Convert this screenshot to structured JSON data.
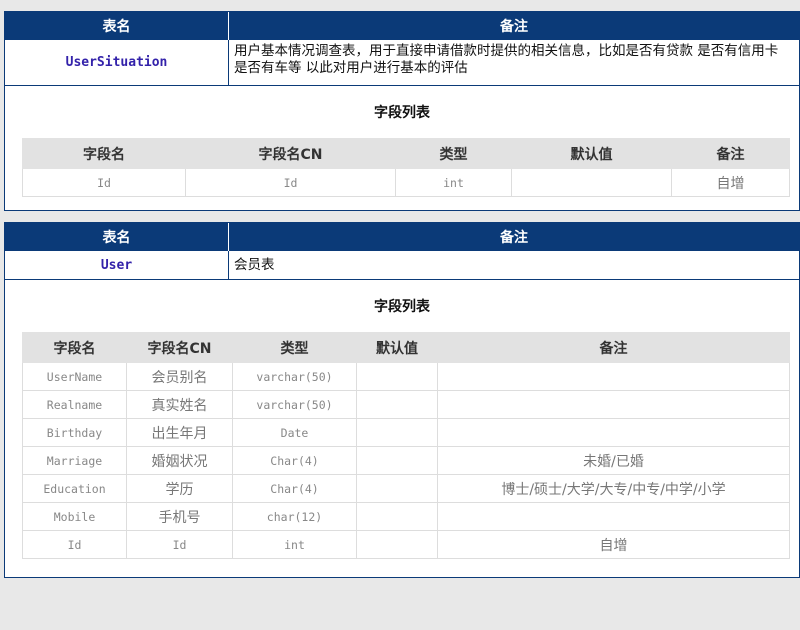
{
  "header": {
    "name_label": "表名",
    "remark_label": "备注"
  },
  "fields_title": "字段列表",
  "columns": [
    "字段名",
    "字段名CN",
    "类型",
    "默认值",
    "备注"
  ],
  "tables": [
    {
      "name": "UserSituation",
      "remark": "用户基本情况调查表，用于直接申请借款时提供的相关信息，比如是否有贷款 是否有信用卡 是否有车等 以此对用户进行基本的评估",
      "rows": [
        {
          "field": "Id",
          "field_cn": "Id",
          "type": "int",
          "default": "",
          "remark": "自增"
        }
      ]
    },
    {
      "name": "User",
      "remark": "会员表",
      "rows": [
        {
          "field": "UserName",
          "field_cn": "会员别名",
          "type": "varchar(50)",
          "default": "",
          "remark": ""
        },
        {
          "field": "Realname",
          "field_cn": "真实姓名",
          "type": "varchar(50)",
          "default": "",
          "remark": ""
        },
        {
          "field": "Birthday",
          "field_cn": "出生年月",
          "type": "Date",
          "default": "",
          "remark": ""
        },
        {
          "field": "Marriage",
          "field_cn": "婚姻状况",
          "type": "Char(4)",
          "default": "",
          "remark": "未婚/已婚"
        },
        {
          "field": "Education",
          "field_cn": "学历",
          "type": "Char(4)",
          "default": "",
          "remark": "博士/硕士/大学/大专/中专/中学/小学"
        },
        {
          "field": "Mobile",
          "field_cn": "手机号",
          "type": "char(12)",
          "default": "",
          "remark": ""
        },
        {
          "field": "Id",
          "field_cn": "Id",
          "type": "int",
          "default": "",
          "remark": "自增"
        }
      ]
    }
  ]
}
